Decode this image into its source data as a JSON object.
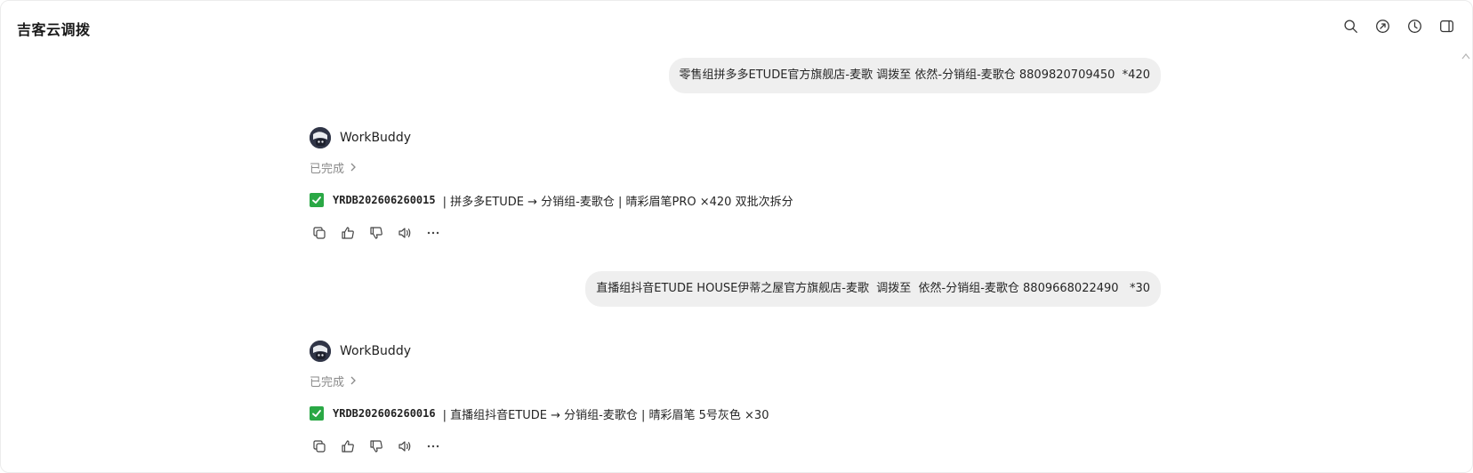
{
  "app": {
    "title": "吉客云调拨"
  },
  "toolbar": {
    "icons": [
      "search-icon",
      "share-icon",
      "history-icon",
      "sidebar-toggle-icon"
    ]
  },
  "messages": [
    {
      "user_text": "零售组拼多多ETUDE官方旗舰店-麦歌 调拨至 依然-分销组-麦歌仓 8809820709450  *420",
      "bot_name": "WorkBuddy",
      "status": "已完成",
      "result_icon": "check-icon",
      "result_code": "YRDB202606260015",
      "result_text": "| 拼多多ETUDE → 分销组-麦歌仓 | 晴彩眉笔PRO ×420 双批次拆分"
    },
    {
      "user_text": "直播组抖音ETUDE HOUSE伊蒂之屋官方旗舰店-麦歌  调拨至  依然-分销组-麦歌仓 8809668022490   *30",
      "bot_name": "WorkBuddy",
      "status": "已完成",
      "result_icon": "check-icon",
      "result_code": "YRDB202606260016",
      "result_text": "| 直播组抖音ETUDE → 分销组-麦歌仓 | 晴彩眉笔 5号灰色 ×30"
    }
  ],
  "message_actions": [
    "copy-icon",
    "thumbs-up-icon",
    "thumbs-down-icon",
    "speaker-icon",
    "more-icon"
  ],
  "colors": {
    "bubble_bg": "#efefef",
    "check_green": "#2aa845",
    "status_gray": "#8a8a8a",
    "avatar_bg": "#2f3446"
  }
}
